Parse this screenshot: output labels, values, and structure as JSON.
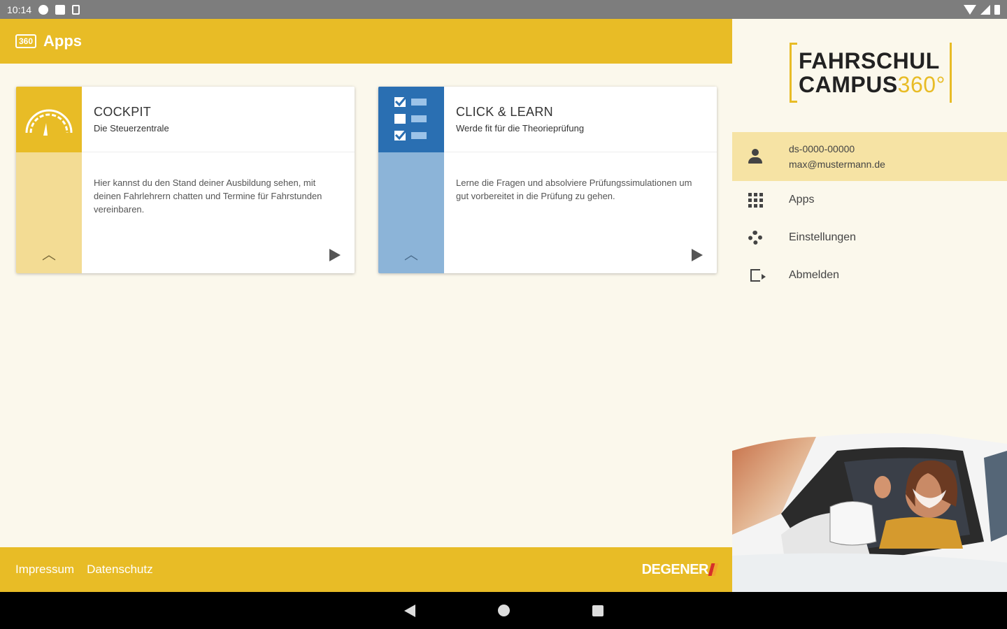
{
  "status_bar": {
    "time": "10:14"
  },
  "app_bar": {
    "logo_text": "360",
    "title": "Apps"
  },
  "cards": [
    {
      "title": "COCKPIT",
      "subtitle": "Die Steuerzentrale",
      "description": "Hier kannst du den Stand deiner Ausbildung sehen, mit deinen Fahrlehrern chatten und Termine für Fahrstunden vereinbaren.",
      "accent": "#e8bc26",
      "side_color": "#f3dc94",
      "icon": "speedometer-icon"
    },
    {
      "title": "CLICK & LEARN",
      "subtitle": "Werde fit für die Theorieprüfung",
      "description": "Lerne die Fragen und absolviere Prüfungssimulationen um gut vorbereitet in die Prüfung zu gehen.",
      "accent": "#2a6fb2",
      "side_color": "#8cb4d8",
      "icon": "checklist-icon"
    }
  ],
  "footer": {
    "links": [
      "Impressum",
      "Datenschutz"
    ],
    "brand": "DEGENER"
  },
  "drawer": {
    "brand_line1": "FAHRSCHUL",
    "brand_line2_text": "CAMPUS",
    "brand_line2_number": "360°",
    "account": {
      "id": "ds-0000-00000",
      "email": "max@mustermann.de"
    },
    "items": [
      {
        "label": "Apps",
        "icon": "apps-grid-icon"
      },
      {
        "label": "Einstellungen",
        "icon": "gear-icon"
      },
      {
        "label": "Abmelden",
        "icon": "logout-icon"
      }
    ]
  },
  "colors": {
    "primary": "#e8bc26",
    "background": "#fbf8ec",
    "learn_blue": "#2a6fb2"
  }
}
